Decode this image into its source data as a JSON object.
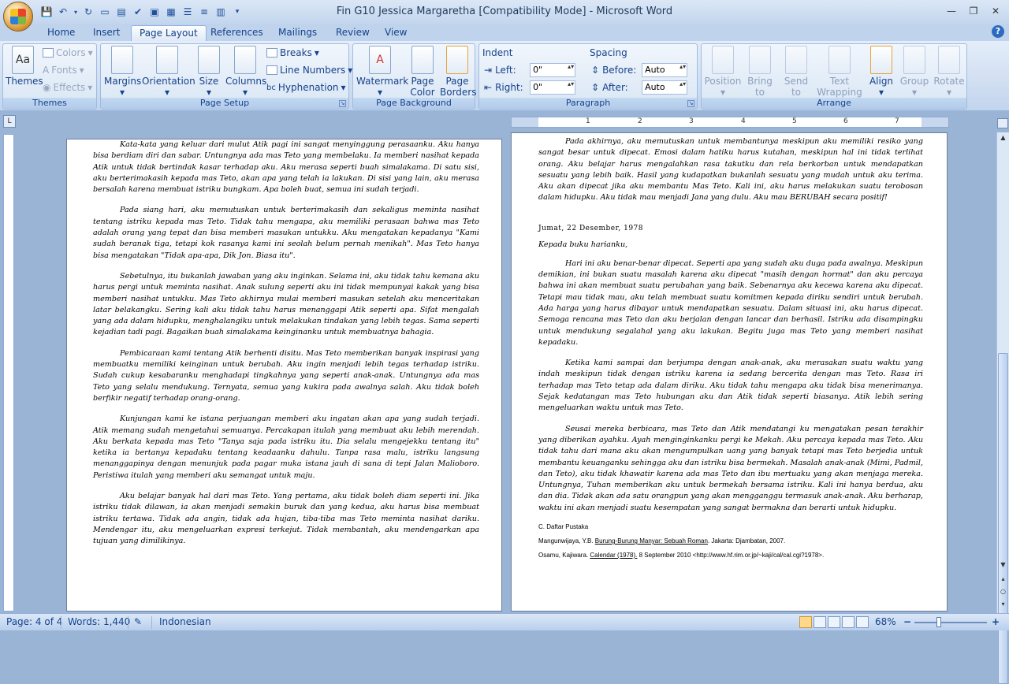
{
  "window": {
    "title": "Fin G10 Jessica Margaretha [Compatibility Mode] - Microsoft Word",
    "controls": [
      "—",
      "❐",
      "✕"
    ]
  },
  "tabs": [
    {
      "label": "Home"
    },
    {
      "label": "Insert"
    },
    {
      "label": "Page Layout",
      "active": true
    },
    {
      "label": "References"
    },
    {
      "label": "Mailings"
    },
    {
      "label": "Review"
    },
    {
      "label": "View"
    }
  ],
  "ribbon": {
    "themes": {
      "label": "Themes",
      "themes_btn": "Themes",
      "colors": "Colors",
      "fonts": "Fonts",
      "effects": "Effects"
    },
    "page_setup": {
      "label": "Page Setup",
      "margins": "Margins",
      "orientation": "Orientation",
      "size": "Size",
      "columns": "Columns",
      "breaks": "Breaks",
      "line_numbers": "Line Numbers",
      "hyphenation": "Hyphenation"
    },
    "page_background": {
      "label": "Page Background",
      "watermark": "Watermark",
      "page_color": "Page Color",
      "page_borders": "Page Borders"
    },
    "paragraph": {
      "label": "Paragraph",
      "indent": "Indent",
      "spacing": "Spacing",
      "left_label": "Left:",
      "left_value": "0\"",
      "right_label": "Right:",
      "right_value": "0\"",
      "before_label": "Before:",
      "before_value": "Auto",
      "after_label": "After:",
      "after_value": "Auto"
    },
    "arrange": {
      "label": "Arrange",
      "position": "Position",
      "bring_to_front": "Bring to Front",
      "send_to_back": "Send to Back",
      "text_wrapping": "Text Wrapping",
      "align": "Align",
      "group": "Group",
      "rotate": "Rotate"
    }
  },
  "ruler_numbers": [
    "1",
    "2",
    "3",
    "4",
    "5",
    "6",
    "7"
  ],
  "left_page": {
    "paragraphs": [
      "Kata-kata yang keluar dari mulut Atik pagi ini sangat menyinggung perasaanku. Aku hanya bisa berdiam diri dan sabar. Untungnya ada mas Teto yang membelaku. Ia memberi nasihat kepada Atik untuk tidak bertindak kasar terhadap aku. Aku merasa seperti buah simalakama. Di satu sisi, aku berterimakasih kepada mas Teto, akan apa yang telah ia lakukan. Di sisi yang lain, aku merasa bersalah karena membuat istriku bungkam. Apa boleh buat, semua ini sudah terjadi.",
      "Pada siang hari, aku memutuskan untuk berterimakasih dan sekaligus meminta nasihat tentang istriku kepada mas Teto. Tidak tahu mengapa, aku memiliki perasaan bahwa mas Teto adalah orang yang tepat dan bisa memberi masukan untukku. Aku mengatakan kepadanya \"Kami sudah beranak tiga, tetapi kok rasanya kami ini seolah belum pernah menikah\". Mas Teto hanya bisa mengatakan \"Tidak apa-apa, Dik Jon. Biasa itu\".",
      "Sebetulnya, itu bukanlah jawaban yang aku inginkan. Selama ini, aku tidak tahu kemana aku harus pergi untuk meminta nasihat. Anak sulung seperti aku ini tidak mempunyai kakak yang bisa memberi nasihat untukku. Mas Teto akhirnya mulai memberi masukan setelah aku menceritakan latar belakangku. Sering kali aku tidak tahu harus menanggapi Atik seperti apa. Sifat mengalah yang ada dalam hidupku, menghalangiku untuk melakukan tindakan yang lebih tegas. Sama seperti kejadian tadi pagi. Bagaikan buah simalakama keinginanku untuk membuatnya bahagia.",
      "Pembicaraan kami tentang Atik berhenti disitu. Mas Teto memberikan banyak inspirasi yang membuatku memiliki keinginan untuk berubah. Aku ingin menjadi lebih tegas terhadap istriku. Sudah cukup kesabaranku menghadapi tingkahnya yang seperti anak-anak. Untungnya ada mas Teto yang selalu mendukung. Ternyata, semua yang kukira pada awalnya salah. Aku tidak boleh berfikir negatif terhadap orang-orang.",
      "Kunjungan kami ke istana perjuangan memberi aku ingatan akan apa yang sudah terjadi. Atik memang sudah mengetahui semuanya. Percakapan itulah yang membuat aku lebih merendah. Aku berkata kepada mas Teto \"Tanya saja pada istriku itu. Dia selalu mengejekku tentang itu\" ketika ia bertanya kepadaku tentang keadaanku dahulu. Tanpa rasa malu, istriku langsung menanggapinya dengan menunjuk pada pagar muka istana jauh di sana di tepi Jalan Malioboro. Peristiwa itulah yang memberi aku semangat untuk maju.",
      "Aku belajar banyak hal dari mas Teto. Yang pertama, aku tidak boleh diam seperti ini. Jika istriku tidak dilawan, ia akan menjadi semakin buruk dan yang kedua, aku harus bisa membuat istriku tertawa. Tidak ada angin, tidak ada hujan, tiba-tiba mas Teto meminta nasihat dariku. Mendengar itu, aku mengeluarkan expresi terkejut. Tidak membantah, aku mendengarkan apa tujuan yang dimilikinya."
    ]
  },
  "right_page": {
    "p1": "Pada akhirnya, aku memutuskan untuk membantunya meskipun aku memiliki resiko yang sangat besar untuk dipecat. Emosi dalam hatiku harus kutahan, meskipun hal ini tidak terlihat orang. Aku belajar harus mengalahkan rasa takutku dan rela berkorban untuk mendapatkan sesuatu yang lebih baik. Hasil yang kudapatkan bukanlah sesuatu yang mudah untuk aku terima. Aku akan dipecat jika aku membantu Mas Teto. Kali ini, aku harus melakukan suatu terobosan dalam hidupku. Aku tidak mau menjadi Jana yang dulu. Aku mau BERUBAH secara positif!",
    "date": "Jumat, 22 Desember, 1978",
    "salutation": "Kepada buku harianku,",
    "p2": "Hari ini aku benar-benar dipecat. Seperti apa yang sudah aku duga pada awalnya. Meskipun demikian, ini bukan suatu masalah karena aku dipecat \"masih dengan hormat\" dan aku percaya bahwa ini akan membuat suatu perubahan yang baik. Sebenarnya aku kecewa karena aku dipecat. Tetapi mau tidak mau, aku telah membuat suatu komitmen kepada diriku sendiri untuk berubah. Ada harga yang harus dibayar untuk mendapatkan sesuatu. Dalam situasi ini, aku harus dipecat. Semoga rencana mas Teto dan aku berjalan dengan lancar dan berhasil. Istriku ada disampingku untuk mendukung segalahal yang aku lakukan. Begitu juga mas Teto yang memberi nasihat kepadaku.",
    "p3": "Ketika kami sampai dan berjumpa dengan anak-anak, aku merasakan suatu waktu yang indah meskipun tidak dengan istriku karena ia sedang bercerita dengan mas Teto. Rasa iri terhadap mas Teto tetap ada dalam diriku. Aku tidak tahu mengapa aku tidak bisa menerimanya. Sejak kedatangan mas Teto hubungan aku dan Atik tidak seperti biasanya. Atik lebih sering mengeluarkan waktu untuk mas Teto.",
    "p4": "Seusai mereka berbicara, mas Teto dan Atik mendatangi ku mengatakan pesan terakhir yang diberikan ayahku. Ayah menginginkanku pergi ke Mekah. Aku percaya kepada mas Teto. Aku tidak tahu dari mana aku akan mengumpulkan uang yang banyak tetapi mas Teto berjedia untuk membantu keuanganku sehingga aku dan istriku bisa bermekah. Masalah anak-anak (Mimi, Padmil, dan Teto), aku tidak khawatir karena ada mas Teto dan ibu mertuaku yang akan menjaga mereka. Untungnya, Tuhan memberikan aku untuk bermekah bersama istriku. Kali ini hanya berdua, aku dan dia. Tidak akan ada satu orangpun yang akan mengganggu termasuk anak-anak. Aku berharap, waktu ini akan menjadi suatu kesempatan yang sangat bermakna dan berarti untuk hidupku.",
    "biblio_heading": "C. Daftar Pustaka",
    "ref1_pre": "Mangunwijaya, Y.B. ",
    "ref1_title": "Burung-Burung Manyar: Sebuah Roman",
    "ref1_post": ". Jakarta: Djambatan, 2007.",
    "ref2_pre": "Osamu, Kajiwara. ",
    "ref2_title": "Calendar (1978).",
    "ref2_post": " 8 September 2010 <http://www.hf.rim.or.jp/~kaji/cal/cal.cgi?1978>."
  },
  "status": {
    "page": "Page: 4 of 4",
    "words": "Words: 1,440",
    "language": "Indonesian",
    "zoom": "68%",
    "minus": "−",
    "plus": "+"
  }
}
